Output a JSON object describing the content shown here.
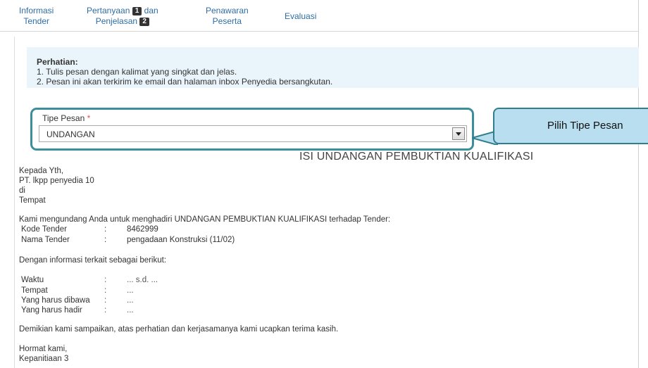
{
  "tabs": [
    {
      "line1": "Informasi",
      "line2": "Tender"
    },
    {
      "line1": "Pertanyaan",
      "badge1": "1",
      "mid": "dan",
      "line2": "Penjelasan",
      "badge2": "2"
    },
    {
      "line1": "Penawaran",
      "line2": "Peserta"
    },
    {
      "line1": "Evaluasi"
    }
  ],
  "notice": {
    "title": "Perhatian:",
    "line1": "1. Tulis pesan dengan kalimat yang singkat dan jelas.",
    "line2": "2. Pesan ini akan terkirim ke email dan halaman inbox Penyedia bersangkutan."
  },
  "form": {
    "tipe_label": "Tipe Pesan",
    "required": "*",
    "selected": "UNDANGAN"
  },
  "callout": "Pilih Tipe Pesan",
  "message": {
    "heading": "ISI UNDANGAN PEMBUKTIAN KUALIFIKASI",
    "kepada": "Kepada Yth,",
    "recipient": "PT. lkpp penyedia 10",
    "di": "di",
    "tempat": "Tempat",
    "intro": "Kami mengundang Anda untuk menghadiri UNDANGAN PEMBUKTIAN KUALIFIKASI terhadap Tender:",
    "kode_label": "Kode Tender",
    "kode_value": "8462999",
    "nama_label": "Nama Tender",
    "nama_value": "pengadaan Konstruksi (11/02)",
    "info_intro": "Dengan informasi terkait sebagai berikut:",
    "waktu_label": "Waktu",
    "waktu_value": "... s.d. ...",
    "tempat_label": "Tempat",
    "tempat_value": "...",
    "dibawa_label": "Yang harus dibawa",
    "dibawa_value": "...",
    "hadir_label": "Yang harus hadir",
    "hadir_value": "...",
    "separator": ":",
    "closing": "Demikian kami sampaikan, atas perhatian dan kerjasamanya kami ucapkan terima kasih.",
    "hormat": "Hormat kami,",
    "signature": "Kepanitiaan 3"
  },
  "colors": {
    "link": "#2e6da4",
    "notice_bg": "#eaf4fb",
    "highlight_border": "#3d8e9b",
    "callout_bg": "#b9def0"
  }
}
